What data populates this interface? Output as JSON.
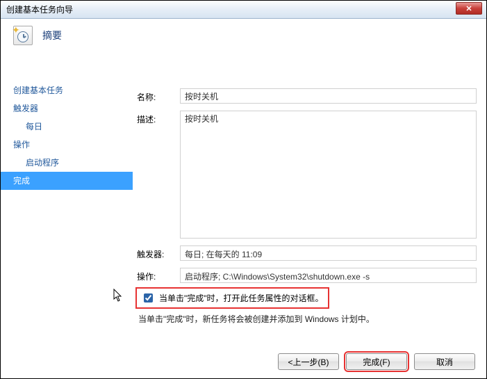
{
  "window": {
    "title": "创建基本任务向导"
  },
  "header": {
    "heading": "摘要"
  },
  "sidebar": {
    "items": [
      {
        "label": "创建基本任务",
        "indent": false,
        "selected": false
      },
      {
        "label": "触发器",
        "indent": false,
        "selected": false
      },
      {
        "label": "每日",
        "indent": true,
        "selected": false
      },
      {
        "label": "操作",
        "indent": false,
        "selected": false
      },
      {
        "label": "启动程序",
        "indent": true,
        "selected": false
      },
      {
        "label": "完成",
        "indent": false,
        "selected": true
      }
    ]
  },
  "form": {
    "name_label": "名称:",
    "name_value": "按时关机",
    "desc_label": "描述:",
    "desc_value": "按时关机",
    "trigger_label": "触发器:",
    "trigger_value": "每日; 在每天的 11:09",
    "action_label": "操作:",
    "action_value": "启动程序; C:\\Windows\\System32\\shutdown.exe -s"
  },
  "checkbox": {
    "checked": true,
    "label": "当单击\"完成\"时，打开此任务属性的对话框。"
  },
  "footer": {
    "note": "当单击\"完成\"时，新任务将会被创建并添加到 Windows 计划中。"
  },
  "buttons": {
    "back": "<上一步(B)",
    "finish": "完成(F)",
    "cancel": "取消"
  },
  "colors": {
    "accent": "#3ba1ff",
    "highlight": "#e73232"
  }
}
